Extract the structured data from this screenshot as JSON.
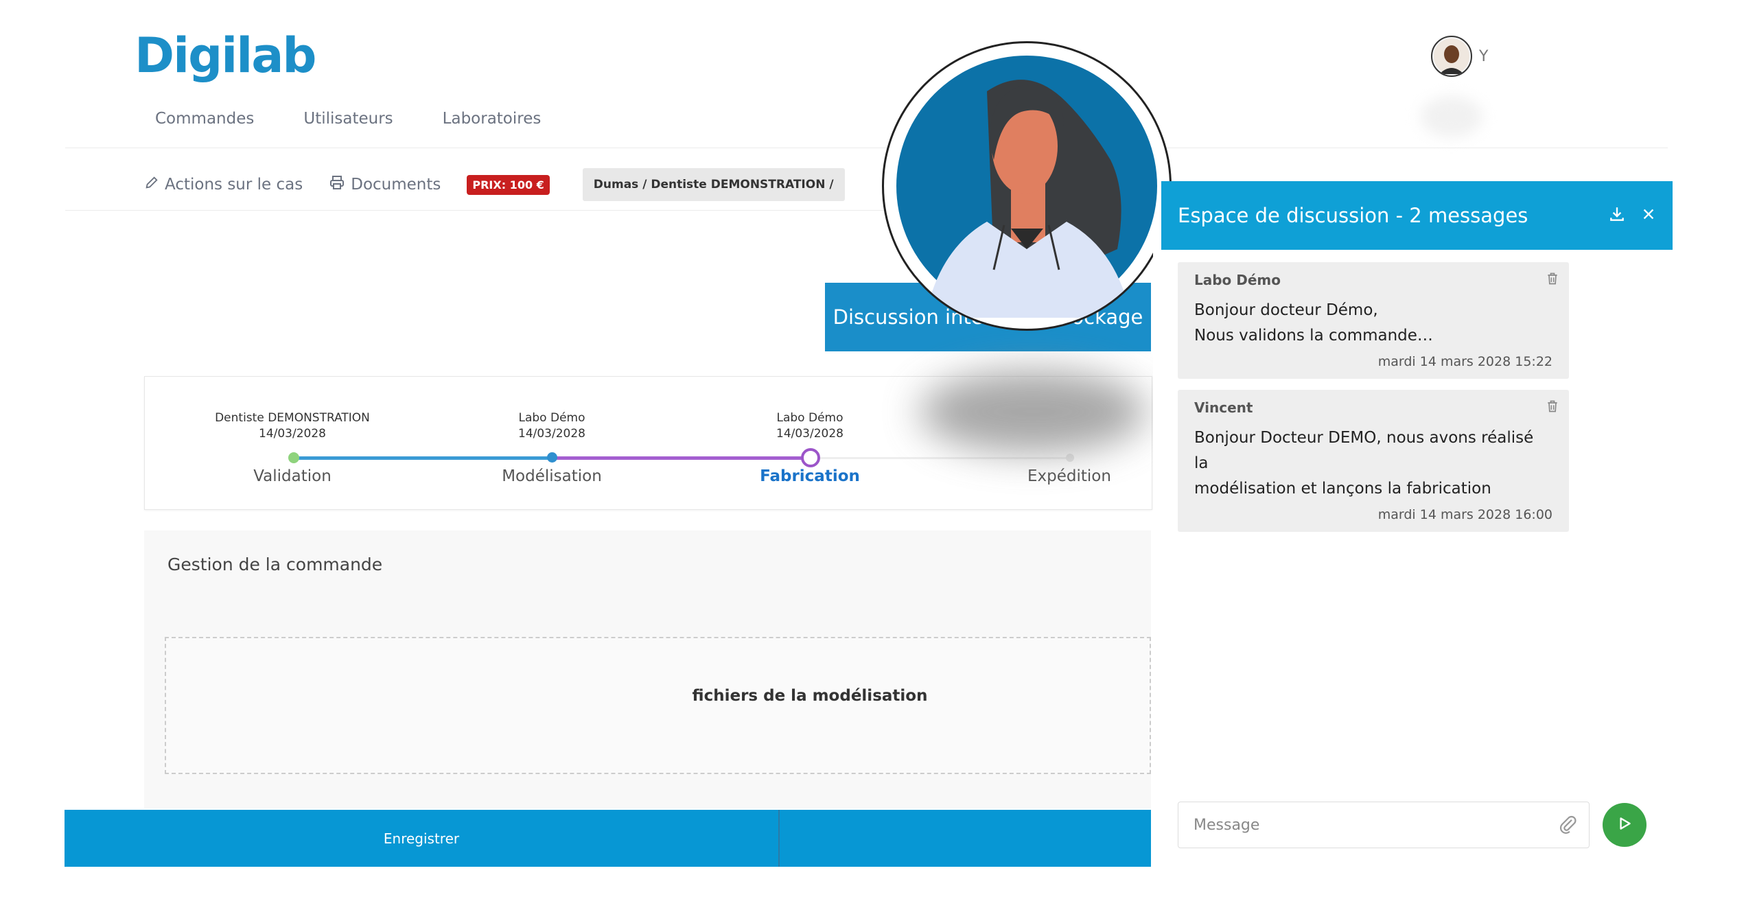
{
  "brand": {
    "name": "Digilab",
    "color": "#1d8fc8"
  },
  "nav": {
    "items": [
      "Commandes",
      "Utilisateurs",
      "Laboratoires"
    ]
  },
  "user": {
    "initial": "Y"
  },
  "toolbar": {
    "actions_label": "Actions sur le cas",
    "documents_label": "Documents",
    "price_badge": "PRIX: 100 €",
    "path": "Dumas / Dentiste DEMONSTRATION /"
  },
  "discussion_button": {
    "label": "Discussion interne au stockage"
  },
  "timeline": {
    "steps": [
      {
        "actor": "Dentiste DEMONSTRATION",
        "date": "14/03/2028",
        "label": "Validation",
        "state": "done"
      },
      {
        "actor": "Labo Démo",
        "date": "14/03/2028",
        "label": "Modélisation",
        "state": "done"
      },
      {
        "actor": "Labo Démo",
        "date": "14/03/2028",
        "label": "Fabrication",
        "state": "active"
      },
      {
        "actor": "",
        "date": "",
        "label": "Expédition",
        "state": "pending"
      }
    ]
  },
  "gestion": {
    "title": "Gestion de la commande",
    "files_label": "fichiers de la modélisation"
  },
  "bottom_bar": {
    "save_label": "Enregistrer"
  },
  "chat": {
    "title": "Espace de discussion - 2 messages",
    "messages": [
      {
        "author": "Labo Démo",
        "lines": [
          "Bonjour docteur Démo,",
          "Nous validons la commande…"
        ],
        "date": "mardi 14 mars 2028 15:22"
      },
      {
        "author": "Vincent",
        "lines": [
          "Bonjour Docteur DEMO, nous avons réalisé la",
          "modélisation et lançons la fabrication"
        ],
        "date": "mardi 14 mars 2028 16:00"
      }
    ],
    "input_placeholder": "Message"
  },
  "colors": {
    "accent": "#0fa0d6",
    "price": "#c81f1f",
    "send": "#3aa547",
    "timeline_done": "#3a9bd5",
    "timeline_purple": "#a45fd0"
  }
}
